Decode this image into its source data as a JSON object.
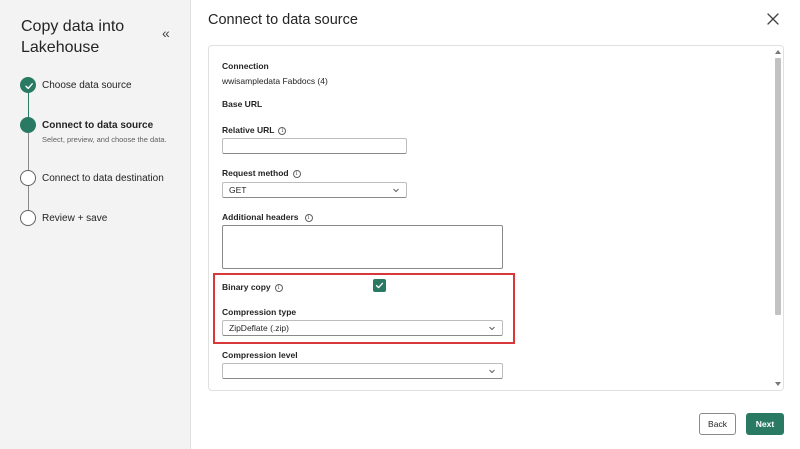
{
  "sidebar": {
    "title": "Copy data into Lakehouse",
    "collapse_glyph": "«",
    "steps": [
      {
        "label": "Choose data source",
        "state": "done"
      },
      {
        "label": "Connect to data source",
        "state": "current",
        "sub": "Select, preview, and choose the data."
      },
      {
        "label": "Connect to data destination",
        "state": "pending"
      },
      {
        "label": "Review + save",
        "state": "pending"
      }
    ]
  },
  "main": {
    "title": "Connect to data source",
    "close_icon": "close-icon"
  },
  "form": {
    "connection_label": "Connection",
    "connection_value": "wwisampledata Fabdocs (4)",
    "base_url_label": "Base URL",
    "relative_url_label": "Relative URL",
    "relative_url_value": "",
    "request_method_label": "Request method",
    "request_method_value": "GET",
    "additional_headers_label": "Additional headers",
    "additional_headers_value": "",
    "binary_copy_label": "Binary copy",
    "binary_copy_checked": true,
    "compression_type_label": "Compression type",
    "compression_type_value": "ZipDeflate (.zip)",
    "compression_level_label": "Compression level",
    "compression_level_value": "",
    "info_glyph": "i"
  },
  "footer": {
    "back_label": "Back",
    "next_label": "Next"
  },
  "colors": {
    "accent": "#2a7a63",
    "highlight": "#d9383b"
  }
}
